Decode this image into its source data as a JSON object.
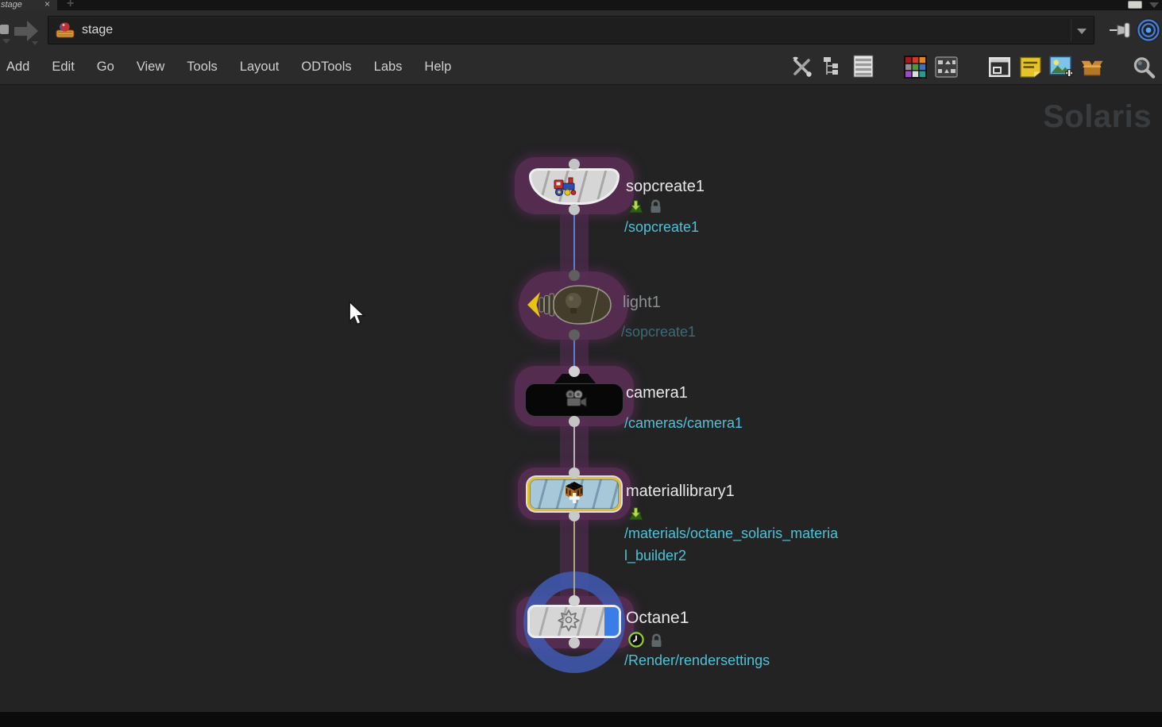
{
  "tab_bar": {
    "tab_title": "stage",
    "close_label": "×",
    "new_tab_label": "+"
  },
  "nav": {
    "path_field_value": "stage"
  },
  "menu_bar": {
    "items": [
      "Add",
      "Edit",
      "Go",
      "View",
      "Tools",
      "Layout",
      "ODTools",
      "Labs",
      "Help"
    ]
  },
  "toolbar": {
    "icons": [
      "tools",
      "tree-view",
      "list-view",
      "color-palette",
      "shape-palette",
      "window-layout",
      "sticky-note",
      "add-image",
      "box",
      "search",
      "visibility"
    ]
  },
  "canvas": {
    "watermark": "Solaris"
  },
  "nodes": [
    {
      "name": "sopcreate1",
      "path": "/sopcreate1",
      "badges": [
        "sop-import",
        "lock"
      ]
    },
    {
      "name": "light1",
      "path": "/sopcreate1",
      "state": "dimmed"
    },
    {
      "name": "camera1",
      "path": "/cameras/camera1"
    },
    {
      "name": "materiallibrary1",
      "path_line1": "/materials/octane_solaris_materia",
      "path_line2": "l_builder2",
      "badges": [
        "sop-import"
      ]
    },
    {
      "name": "Octane1",
      "path": "/Render/rendersettings",
      "badges": [
        "time-dependent",
        "lock"
      ]
    }
  ],
  "colors": {
    "accent_cyan": "#50c1d6",
    "selection_halo": "#582e54",
    "wire_blue": "#5b7cd0",
    "wire_gray": "#b5b5b5",
    "wire_olive": "#a9a97b",
    "display_ring_blue": "#4058ac",
    "selected_flag_yellow": "#e3bc2e",
    "display_flag_blue": "#3b7de8"
  }
}
